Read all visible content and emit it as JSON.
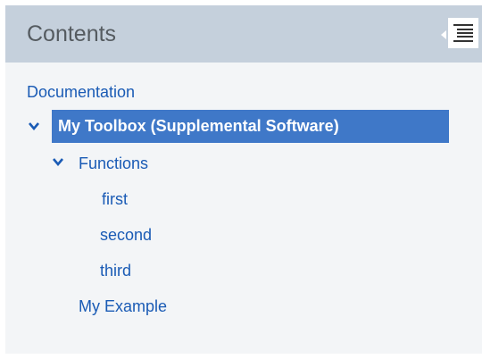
{
  "panel": {
    "title": "Contents",
    "collapse_icon": "toc-collapse-icon"
  },
  "colors": {
    "header_bg": "#c5d0dc",
    "link": "#1a5bb5",
    "selected_bg": "#3f78c8"
  },
  "tree": {
    "root": {
      "label": "Documentation"
    },
    "toolbox": {
      "label": "My Toolbox (Supplemental Software)",
      "expanded": true,
      "selected": true
    },
    "functions": {
      "label": "Functions",
      "expanded": true
    },
    "items": [
      {
        "label": "first"
      },
      {
        "label": "second"
      },
      {
        "label": "third"
      }
    ],
    "example": {
      "label": "My Example"
    }
  }
}
